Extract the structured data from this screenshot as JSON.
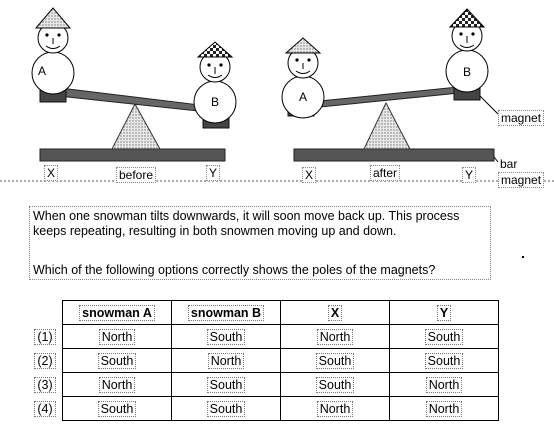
{
  "diagram": {
    "label_a": "A",
    "label_b": "B",
    "label_x": "X",
    "label_y": "Y",
    "before": "before",
    "after": "after",
    "magnet": "magnet",
    "bar_magnet_line1": "bar",
    "bar_magnet_line2": "magnet"
  },
  "question": {
    "text": "When one snowman tilts downwards, it will soon move back up. This process keeps repeating, resulting in both snowmen moving up and down.",
    "prompt": "Which of the following options correctly shows the poles of the magnets?"
  },
  "table": {
    "headers": [
      "snowman A",
      "snowman B",
      "X",
      "Y"
    ],
    "rows": [
      {
        "option": "(1)",
        "values": [
          "North",
          "South",
          "North",
          "South"
        ]
      },
      {
        "option": "(2)",
        "values": [
          "South",
          "North",
          "South",
          "South"
        ]
      },
      {
        "option": "(3)",
        "values": [
          "North",
          "South",
          "South",
          "North"
        ]
      },
      {
        "option": "(4)",
        "values": [
          "South",
          "South",
          "North",
          "North"
        ]
      }
    ]
  }
}
